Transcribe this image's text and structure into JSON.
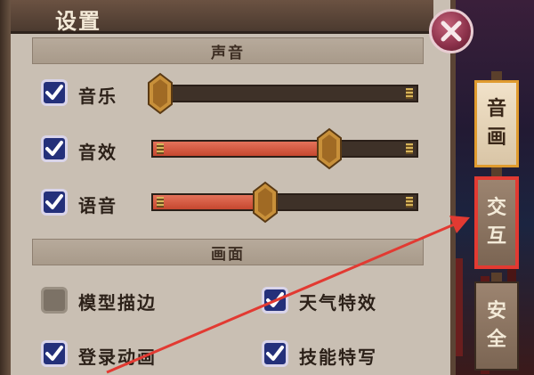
{
  "window": {
    "title": "设置"
  },
  "sections": {
    "sound": {
      "heading": "声音",
      "rows": [
        {
          "label": "音乐",
          "checked": true,
          "level": 0.0
        },
        {
          "label": "音效",
          "checked": true,
          "level": 0.68
        },
        {
          "label": "语音",
          "checked": true,
          "level": 0.42
        }
      ]
    },
    "graphics": {
      "heading": "画面",
      "options": [
        {
          "label": "模型描边",
          "checked": false
        },
        {
          "label": "天气特效",
          "checked": true
        },
        {
          "label": "登录动画",
          "checked": true
        },
        {
          "label": "技能特写",
          "checked": true
        }
      ]
    }
  },
  "tabs": [
    {
      "line1": "音",
      "line2": "画",
      "active": true
    },
    {
      "line1": "交",
      "line2": "互",
      "active": false
    },
    {
      "line1": "安",
      "line2": "全",
      "active": false
    }
  ],
  "colors": {
    "accent_fill": "#d3553c",
    "checkbox": "#24307a",
    "annotation": "#e23a32"
  },
  "icons": {
    "close": "close-icon",
    "check": "check-icon"
  }
}
